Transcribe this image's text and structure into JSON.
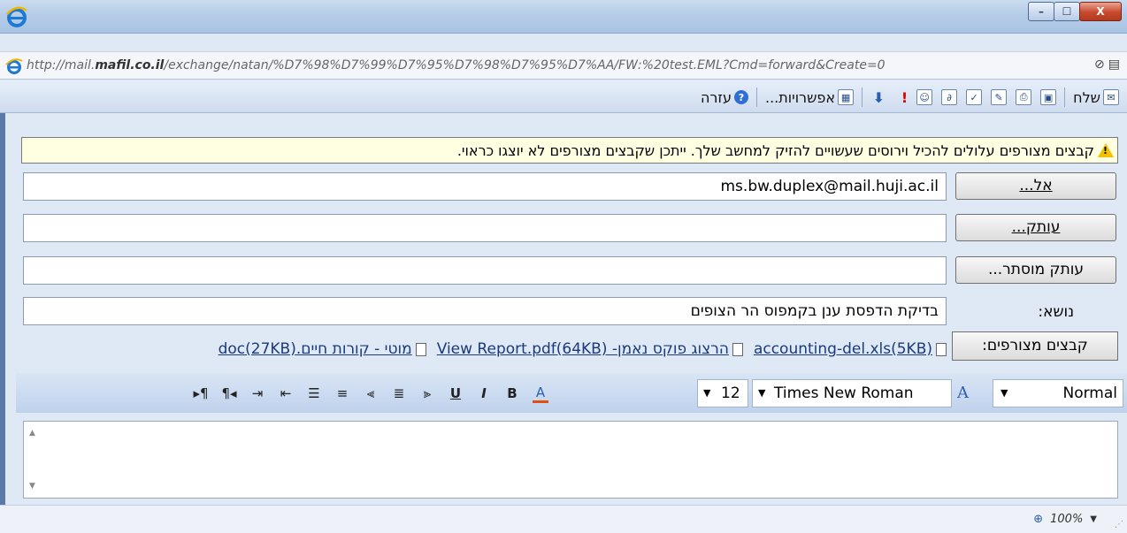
{
  "window": {
    "minimize": "–",
    "maximize": "☐",
    "close": "X"
  },
  "address": {
    "url_prefix": "http://mail.",
    "url_host": "mafil.co.il",
    "url_rest": "/exchange/natan/%D7%98%D7%99%D7%95%D7%98%D7%95%D7%AA/FW:%20test.EML?Cmd=forward&Create=0"
  },
  "toolbar": {
    "send_label": "שלח",
    "options_label": "אפשרויות...",
    "help_label": "עזרה"
  },
  "warning": {
    "text": "קבצים מצורפים עלולים להכיל וירוסים שעשויים להזיק למחשב שלך. ייתכן שקבצים מצורפים לא יוצגו כראוי."
  },
  "form": {
    "to_button": "אל...",
    "to_value": "ms.bw.duplex@mail.huji.ac.il",
    "cc_button": "עותק...",
    "cc_value": "",
    "bcc_button": "עותק מוסתר...",
    "bcc_value": "",
    "subject_label": "נושא:",
    "subject_value": "בדיקת הדפסת ענן בקמפוס הר הצופים",
    "attachments_button": "קבצים מצורפים:",
    "attachments": [
      "accounting-del.xls(5KB)",
      "הרצוג פוקס נאמן- View Report.pdf(64KB)",
      "מוטי - קורות חיים.doc(27KB)"
    ]
  },
  "format": {
    "style": "Normal",
    "font": "Times New Roman",
    "size": "12"
  },
  "status": {
    "zoom": "100%"
  }
}
